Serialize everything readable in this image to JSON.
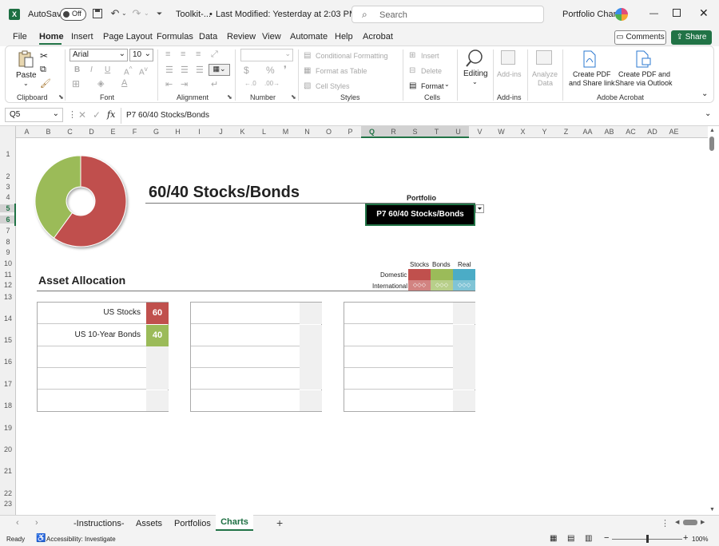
{
  "titlebar": {
    "autosave": "AutoSave",
    "toggle": "Off",
    "doc_name": "Toolkit-...",
    "modified": "Last Modified: Yesterday at 2:03 PM",
    "search": "Search",
    "account": "Portfolio Charts"
  },
  "menu": {
    "items": [
      "File",
      "Home",
      "Insert",
      "Page Layout",
      "Formulas",
      "Data",
      "Review",
      "View",
      "Automate",
      "Help",
      "Acrobat"
    ],
    "active": "Home",
    "comments": "Comments",
    "share": "Share"
  },
  "ribbon": {
    "clipboard": {
      "paste": "Paste",
      "label": "Clipboard"
    },
    "font": {
      "name": "Arial",
      "size": "10",
      "label": "Font",
      "bold": "B",
      "italic": "I",
      "underline": "U"
    },
    "alignment": {
      "label": "Alignment"
    },
    "number": {
      "currency": "$",
      "percent": "%",
      "label": "Number"
    },
    "styles": {
      "cond": "Conditional Formatting",
      "table": "Format as Table",
      "cell": "Cell Styles",
      "label": "Styles"
    },
    "cells": {
      "insert": "Insert",
      "delete": "Delete",
      "format": "Format",
      "label": "Cells"
    },
    "editing": {
      "label": "Editing"
    },
    "addins": {
      "label": "Add-ins",
      "group": "Add-ins"
    },
    "analyze": {
      "line1": "Analyze",
      "line2": "Data"
    },
    "acrobat": {
      "pdf1a": "Create PDF",
      "pdf1b": "and Share link",
      "pdf2a": "Create PDF and",
      "pdf2b": "Share via Outlook",
      "label": "Adobe Acrobat"
    }
  },
  "formula": {
    "namebox": "Q5",
    "fx": "fx",
    "value": "P7  60/40 Stocks/Bonds"
  },
  "columns": [
    "A",
    "B",
    "C",
    "D",
    "E",
    "F",
    "G",
    "H",
    "I",
    "J",
    "K",
    "L",
    "M",
    "N",
    "O",
    "P",
    "Q",
    "R",
    "S",
    "T",
    "U",
    "V",
    "W",
    "X",
    "Y",
    "Z",
    "AA",
    "AB",
    "AC",
    "AD",
    "AE"
  ],
  "rows": [
    "1",
    "2",
    "3",
    "4",
    "5",
    "6",
    "7",
    "8",
    "9",
    "10",
    "11",
    "12",
    "13",
    "14",
    "15",
    "16",
    "17",
    "18",
    "19",
    "20",
    "21",
    "22",
    "23"
  ],
  "sheet": {
    "title": "60/40 Stocks/Bonds",
    "portfolio_label": "Portfolio",
    "portfolio_value": "P7  60/40 Stocks/Bonds",
    "asset_allocation": "Asset Allocation",
    "legend": {
      "cols": [
        "Stocks",
        "Bonds",
        "Real"
      ],
      "rows": [
        "Domestic",
        "International"
      ],
      "colors": [
        "#c0504d",
        "#9bbb59",
        "#4bacc6"
      ],
      "intl_marker": "◇◇◇"
    },
    "allocations": [
      {
        "name": "US Stocks",
        "value": "60",
        "color": "#c0504d"
      },
      {
        "name": "US 10-Year Bonds",
        "value": "40",
        "color": "#9bbb59"
      }
    ]
  },
  "chart_data": {
    "type": "pie",
    "categories": [
      "US Stocks",
      "US 10-Year Bonds"
    ],
    "values": [
      60,
      40
    ],
    "colors": [
      "#c0504d",
      "#9bbb59"
    ]
  },
  "tabs": {
    "items": [
      "-Instructions-",
      "Assets",
      "Portfolios",
      "Charts"
    ],
    "active": "Charts"
  },
  "status": {
    "ready": "Ready",
    "accessibility": "Accessibility: Investigate",
    "zoom": "100%"
  }
}
